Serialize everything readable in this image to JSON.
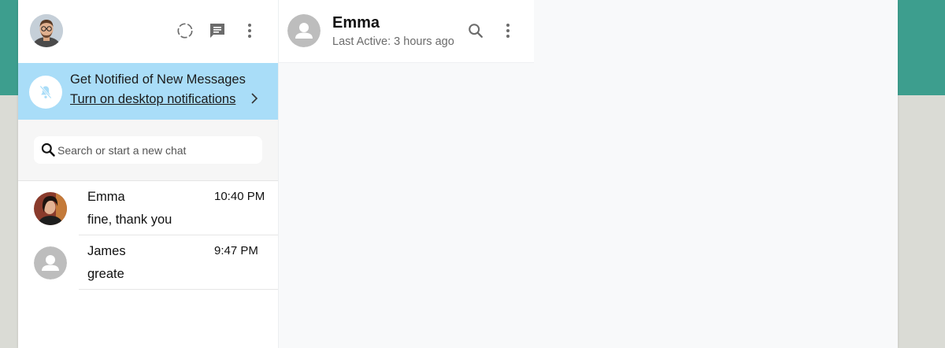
{
  "colors": {
    "teal_band": "#3d9e8e",
    "background": "#dadbd5",
    "banner": "#a9ddf8",
    "placeholder_avatar": "#bdbdbd",
    "icon_gray": "#6b6b6b"
  },
  "sidebar": {
    "header": {
      "icons": [
        "status-icon",
        "new-chat-icon",
        "menu-icon"
      ]
    },
    "notification_banner": {
      "title": "Get Notified of New Messages",
      "link": "Turn on desktop notifications",
      "icon": "bell-off-icon"
    },
    "search": {
      "placeholder": "Search or start a new chat",
      "icon": "search-icon"
    },
    "chats": [
      {
        "name": "Emma",
        "time": "10:40 PM",
        "preview": "fine, thank you"
      },
      {
        "name": "James",
        "time": "9:47 PM",
        "preview": "greate"
      }
    ]
  },
  "conversation": {
    "header": {
      "name": "Emma",
      "status": "Last Active: 3 hours ago",
      "icons": [
        "search-icon",
        "menu-icon"
      ]
    }
  }
}
